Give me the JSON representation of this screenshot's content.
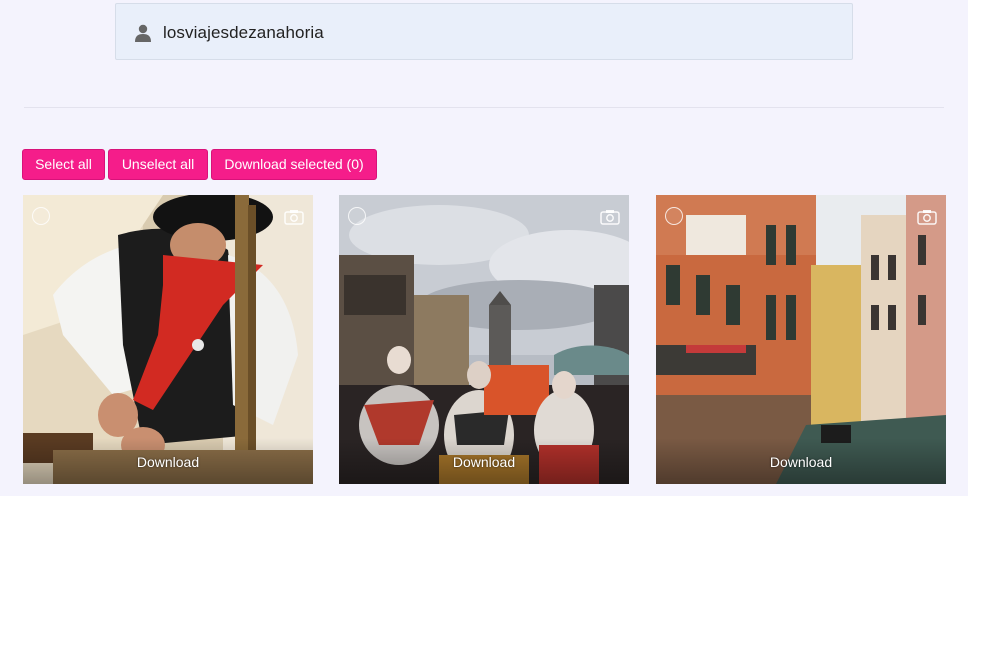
{
  "profile": {
    "username": "losviajesdezanahoria",
    "icon": "user-icon"
  },
  "actions": {
    "select_all": "Select all",
    "unselect_all": "Unselect all",
    "download_selected": "Download selected (0)"
  },
  "photos": [
    {
      "download_label": "Download",
      "icon": "camera-icon",
      "selected": false
    },
    {
      "download_label": "Download",
      "icon": "camera-icon",
      "selected": false
    },
    {
      "download_label": "Download",
      "icon": "camera-icon",
      "selected": false
    }
  ],
  "colors": {
    "accent": "#f51d8a",
    "panel_bg": "#f4f3fd",
    "user_box_bg": "#e9effa"
  }
}
